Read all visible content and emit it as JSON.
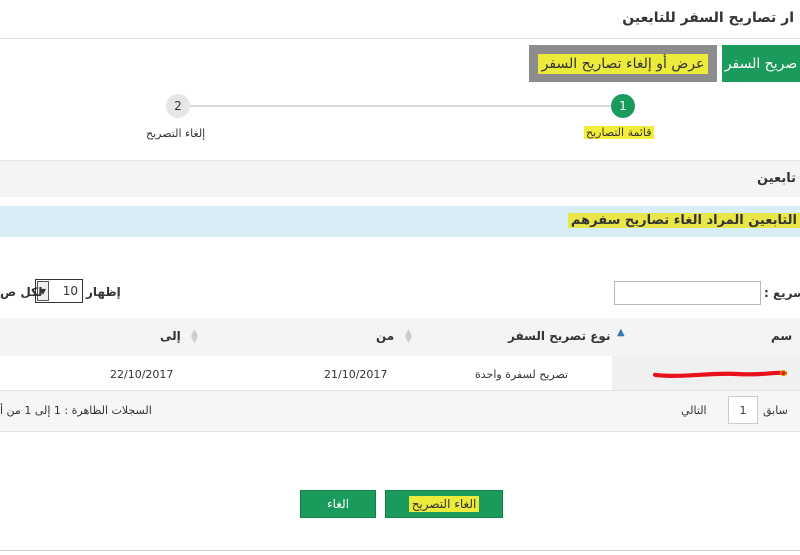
{
  "page": {
    "title": "ار تصاريح السفر للتابعين"
  },
  "tabs": [
    {
      "label": "صريح السفر"
    },
    {
      "label": "عرض أو إلغاء تصاريح السفر"
    }
  ],
  "wizard": {
    "steps": [
      {
        "number": "1",
        "label": "قائمة التصاريح"
      },
      {
        "number": "2",
        "label": "إلغاء التصريح"
      }
    ]
  },
  "section": {
    "title": "تابعين",
    "info": "التابعين المراد الغاء تصاريح سفرهم"
  },
  "table_controls": {
    "search_label": "سريع :",
    "search_value": "",
    "show_label": "إظهار",
    "page_size": "10",
    "per_label": "لكل ص"
  },
  "table": {
    "headers": {
      "name": "سم",
      "type": "نوع تصريح السفر",
      "from": "من",
      "to": "إلى"
    },
    "rows": [
      {
        "type": "تصريح لسفرة واحدة",
        "from": "21/10/2017",
        "to": "22/10/2017"
      }
    ]
  },
  "pagination": {
    "prev": "سابق",
    "page": "1",
    "next": "التالي",
    "records": "السجلات الظاهرة : 1 إلى 1 من أ"
  },
  "buttons": {
    "cancel_permit": "الغاء التصريح",
    "cancel": "الغاء"
  },
  "colors": {
    "primary_green": "#1a9b5c",
    "tab_gray": "#8c8c8c",
    "highlight_yellow": "#ecea3a",
    "info_band": "#d9edf7",
    "redaction_red": "#e8101a"
  }
}
